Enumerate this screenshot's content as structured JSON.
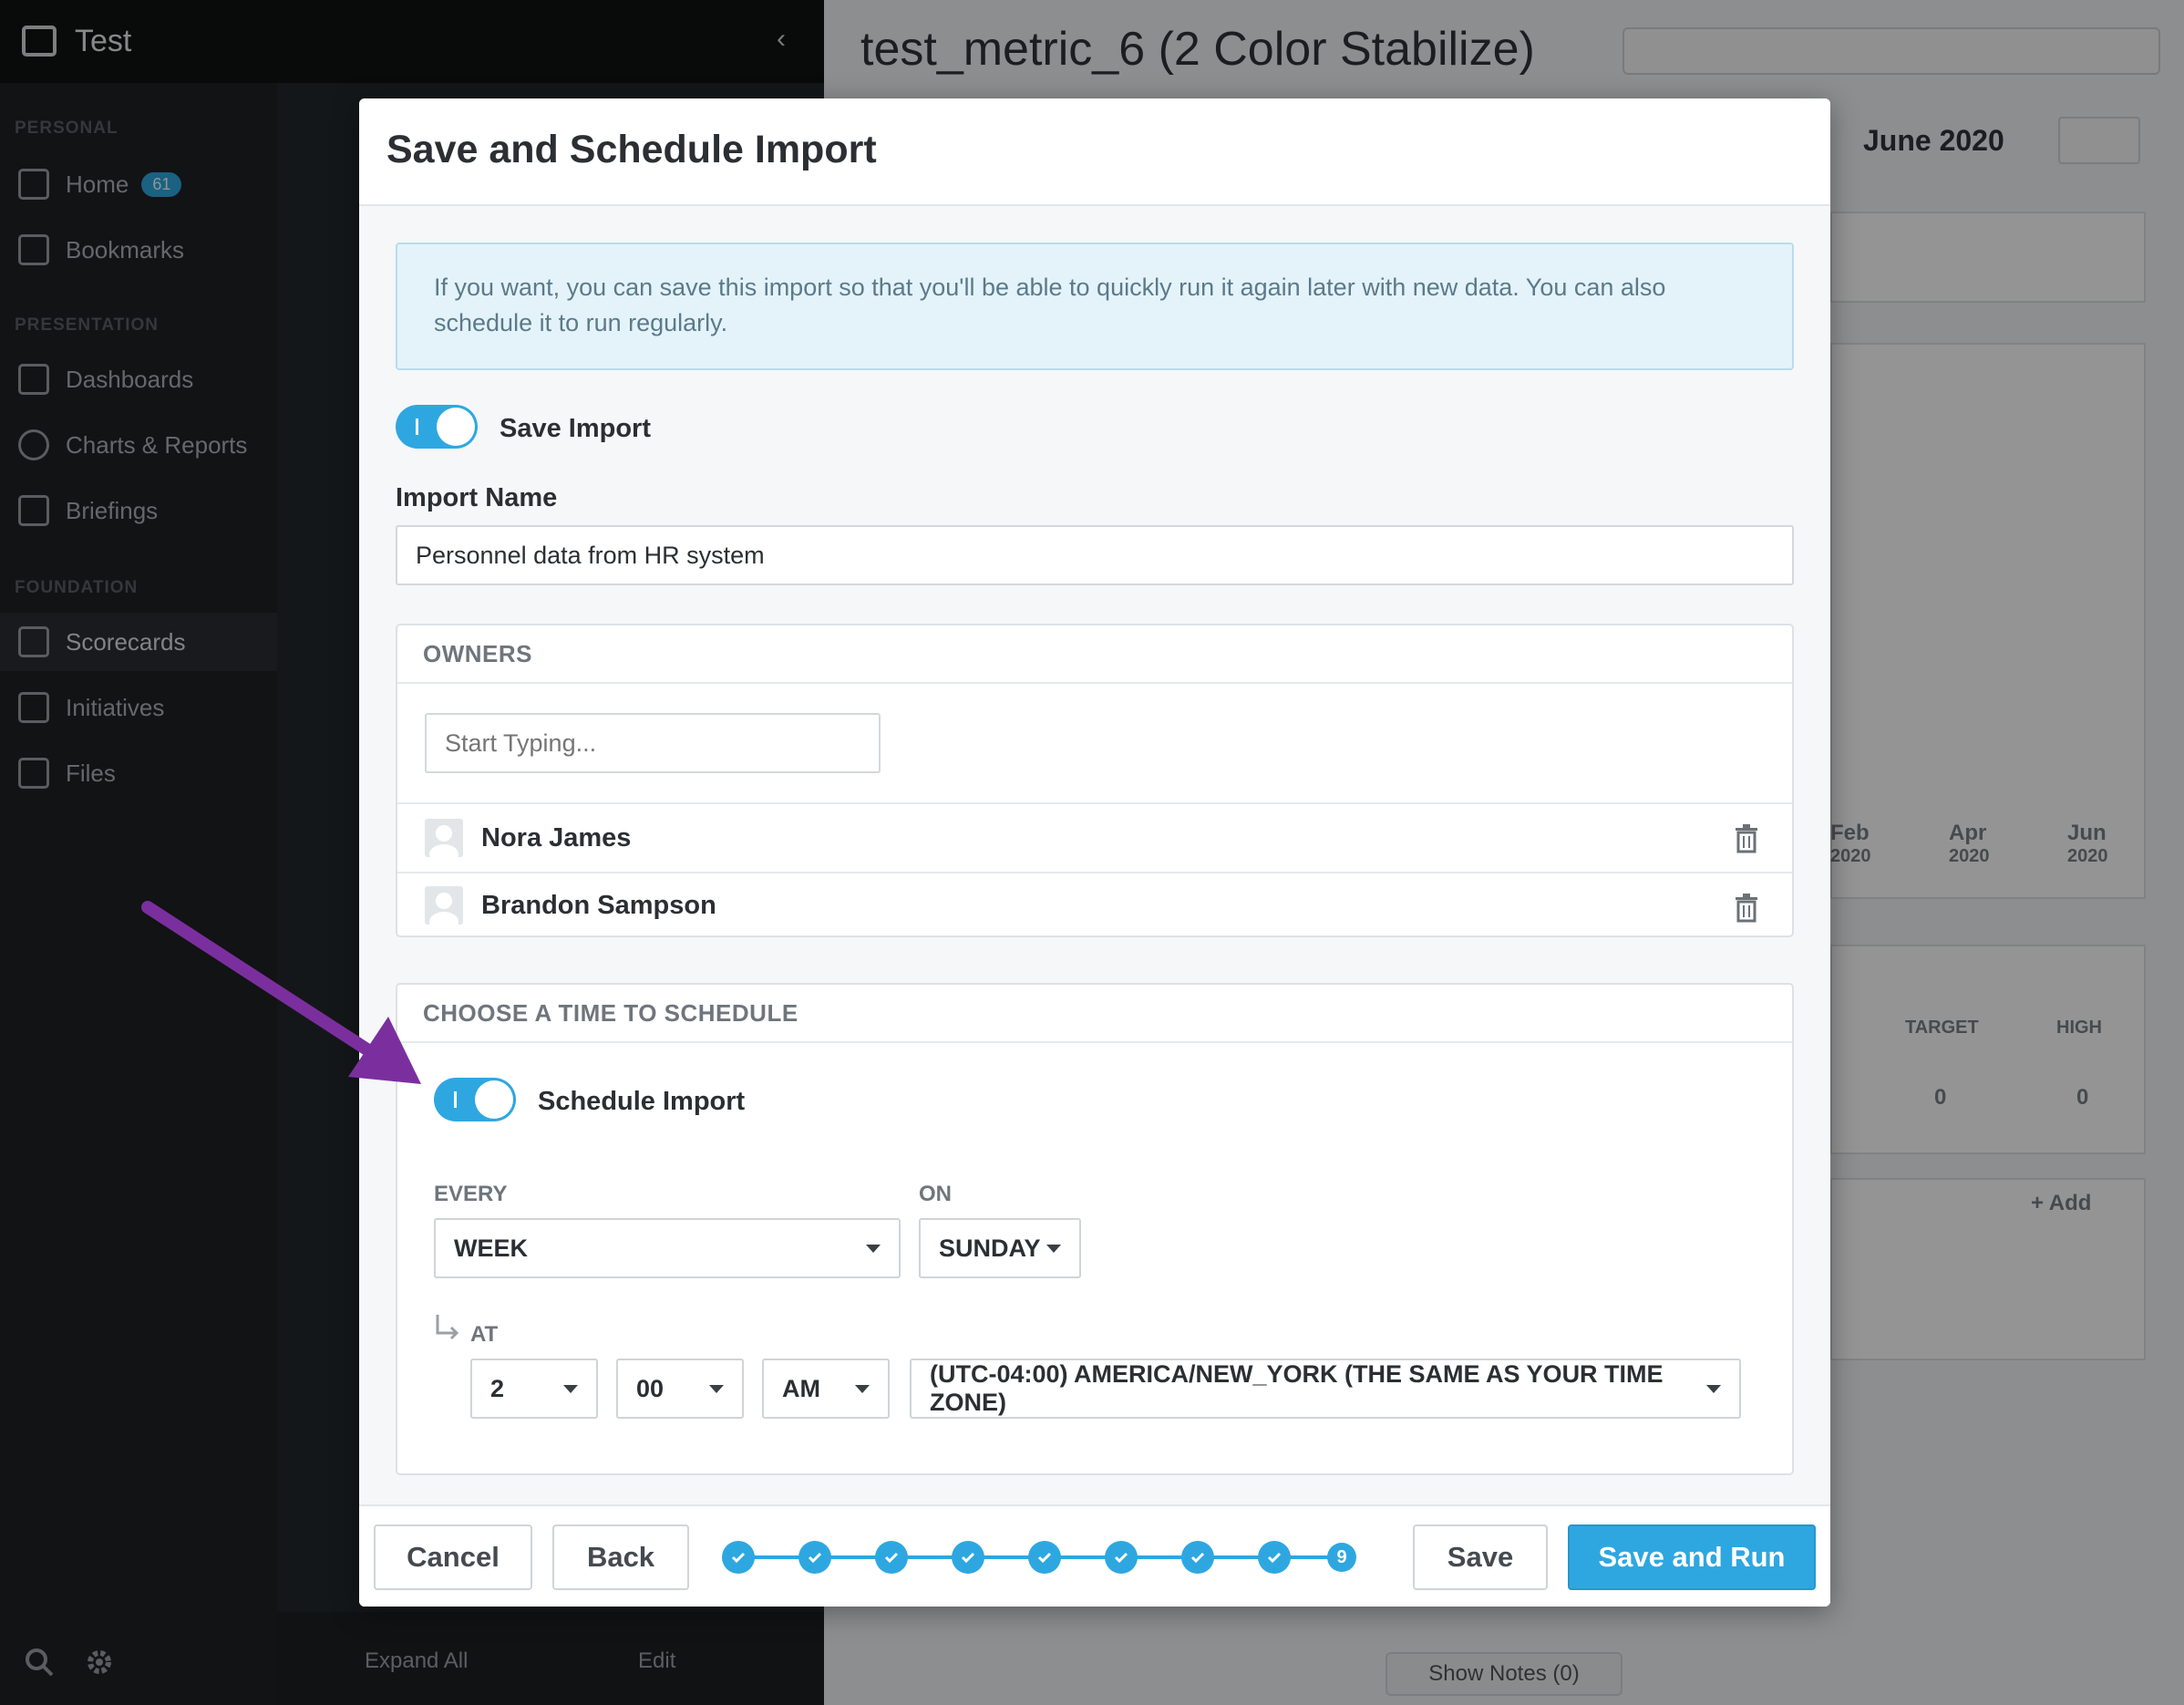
{
  "app": {
    "workspace_name": "Test",
    "page_title": "test_metric_6 (2 Color Stabilize)",
    "period": "June 2020"
  },
  "sidebar": {
    "sections": [
      {
        "label": "PERSONAL"
      },
      {
        "label": "PRESENTATION"
      },
      {
        "label": "FOUNDATION"
      }
    ],
    "items": [
      {
        "label": "Home",
        "badge": "61"
      },
      {
        "label": "Bookmarks"
      },
      {
        "label": "Dashboards"
      },
      {
        "label": "Charts & Reports"
      },
      {
        "label": "Briefings"
      },
      {
        "label": "Scorecards"
      },
      {
        "label": "Initiatives"
      },
      {
        "label": "Files"
      }
    ],
    "bottom_expand": "Expand All",
    "bottom_edit": "Edit"
  },
  "background": {
    "axis_labels": [
      {
        "month": "Feb",
        "year": "2020"
      },
      {
        "month": "Apr",
        "year": "2020"
      },
      {
        "month": "Jun",
        "year": "2020"
      }
    ],
    "col_target": "TARGET",
    "col_high": "HIGH",
    "val_target": "0",
    "val_high": "0",
    "add_label": "+ Add",
    "show_notes": "Show Notes (0)"
  },
  "modal": {
    "title": "Save and Schedule Import",
    "info_text": "If you want, you can save this import so that you'll be able to quickly run it again later with new data. You can also schedule it to run regularly.",
    "save_import_label": "Save Import",
    "import_name_label": "Import Name",
    "import_name_value": "Personnel data from HR system",
    "owners": {
      "heading": "OWNERS",
      "placeholder": "Start Typing...",
      "list": [
        {
          "name": "Nora James"
        },
        {
          "name": "Brandon Sampson"
        }
      ]
    },
    "schedule": {
      "heading": "CHOOSE A TIME TO SCHEDULE",
      "toggle_label": "Schedule Import",
      "every_label": "EVERY",
      "every_value": "WEEK",
      "on_label": "ON",
      "on_value": "SUNDAY",
      "at_label": "AT",
      "hour": "2",
      "minute": "00",
      "ampm": "AM",
      "timezone": "(UTC-04:00) AMERICA/NEW_YORK (THE SAME AS YOUR TIME ZONE)"
    },
    "footer": {
      "cancel": "Cancel",
      "back": "Back",
      "save": "Save",
      "save_and_run": "Save and Run",
      "current_step": "9"
    }
  },
  "colors": {
    "accent": "#2ea7e0",
    "annotation_arrow": "#7b2f9e"
  }
}
